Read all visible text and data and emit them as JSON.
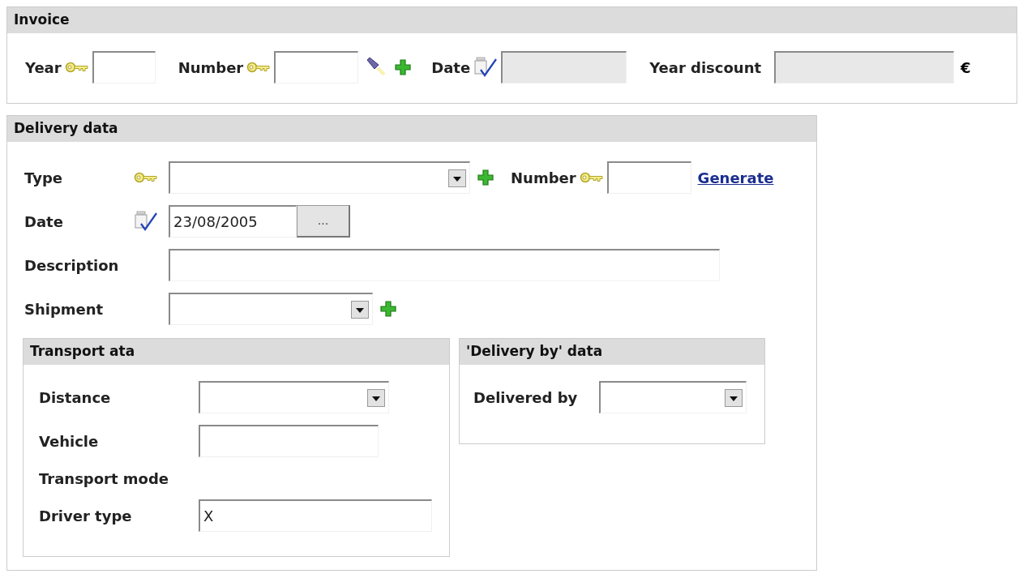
{
  "invoice": {
    "title": "Invoice",
    "currency": "€",
    "fields": [
      {
        "label": "Year",
        "disabled": false
      },
      {
        "label": "Number",
        "disabled": false
      },
      {
        "label": "Date",
        "disabled": true
      },
      {
        "label": "Year discount",
        "disabled": true
      }
    ]
  },
  "delivery": {
    "title": "Delivery data",
    "type": {
      "label": "Type"
    },
    "number": {
      "label": "Number"
    },
    "generate_link": "Generate",
    "date": {
      "label": "Date",
      "value": "23/08/2005",
      "button": "..."
    },
    "description": {
      "label": "Description"
    },
    "shipment": {
      "label": "Shipment"
    },
    "transport": {
      "title": "Transport ata",
      "rows": [
        {
          "kind": "select",
          "label": "Distance"
        },
        {
          "kind": "text",
          "label": "Vehicle"
        },
        {
          "kind": "label",
          "label": "Transport mode"
        },
        {
          "kind": "text",
          "label": "Driver type",
          "value": "X"
        }
      ]
    },
    "delivery_by": {
      "title": "'Delivery by' data",
      "rows": [
        {
          "kind": "select",
          "label": "Delivered by"
        }
      ]
    }
  }
}
